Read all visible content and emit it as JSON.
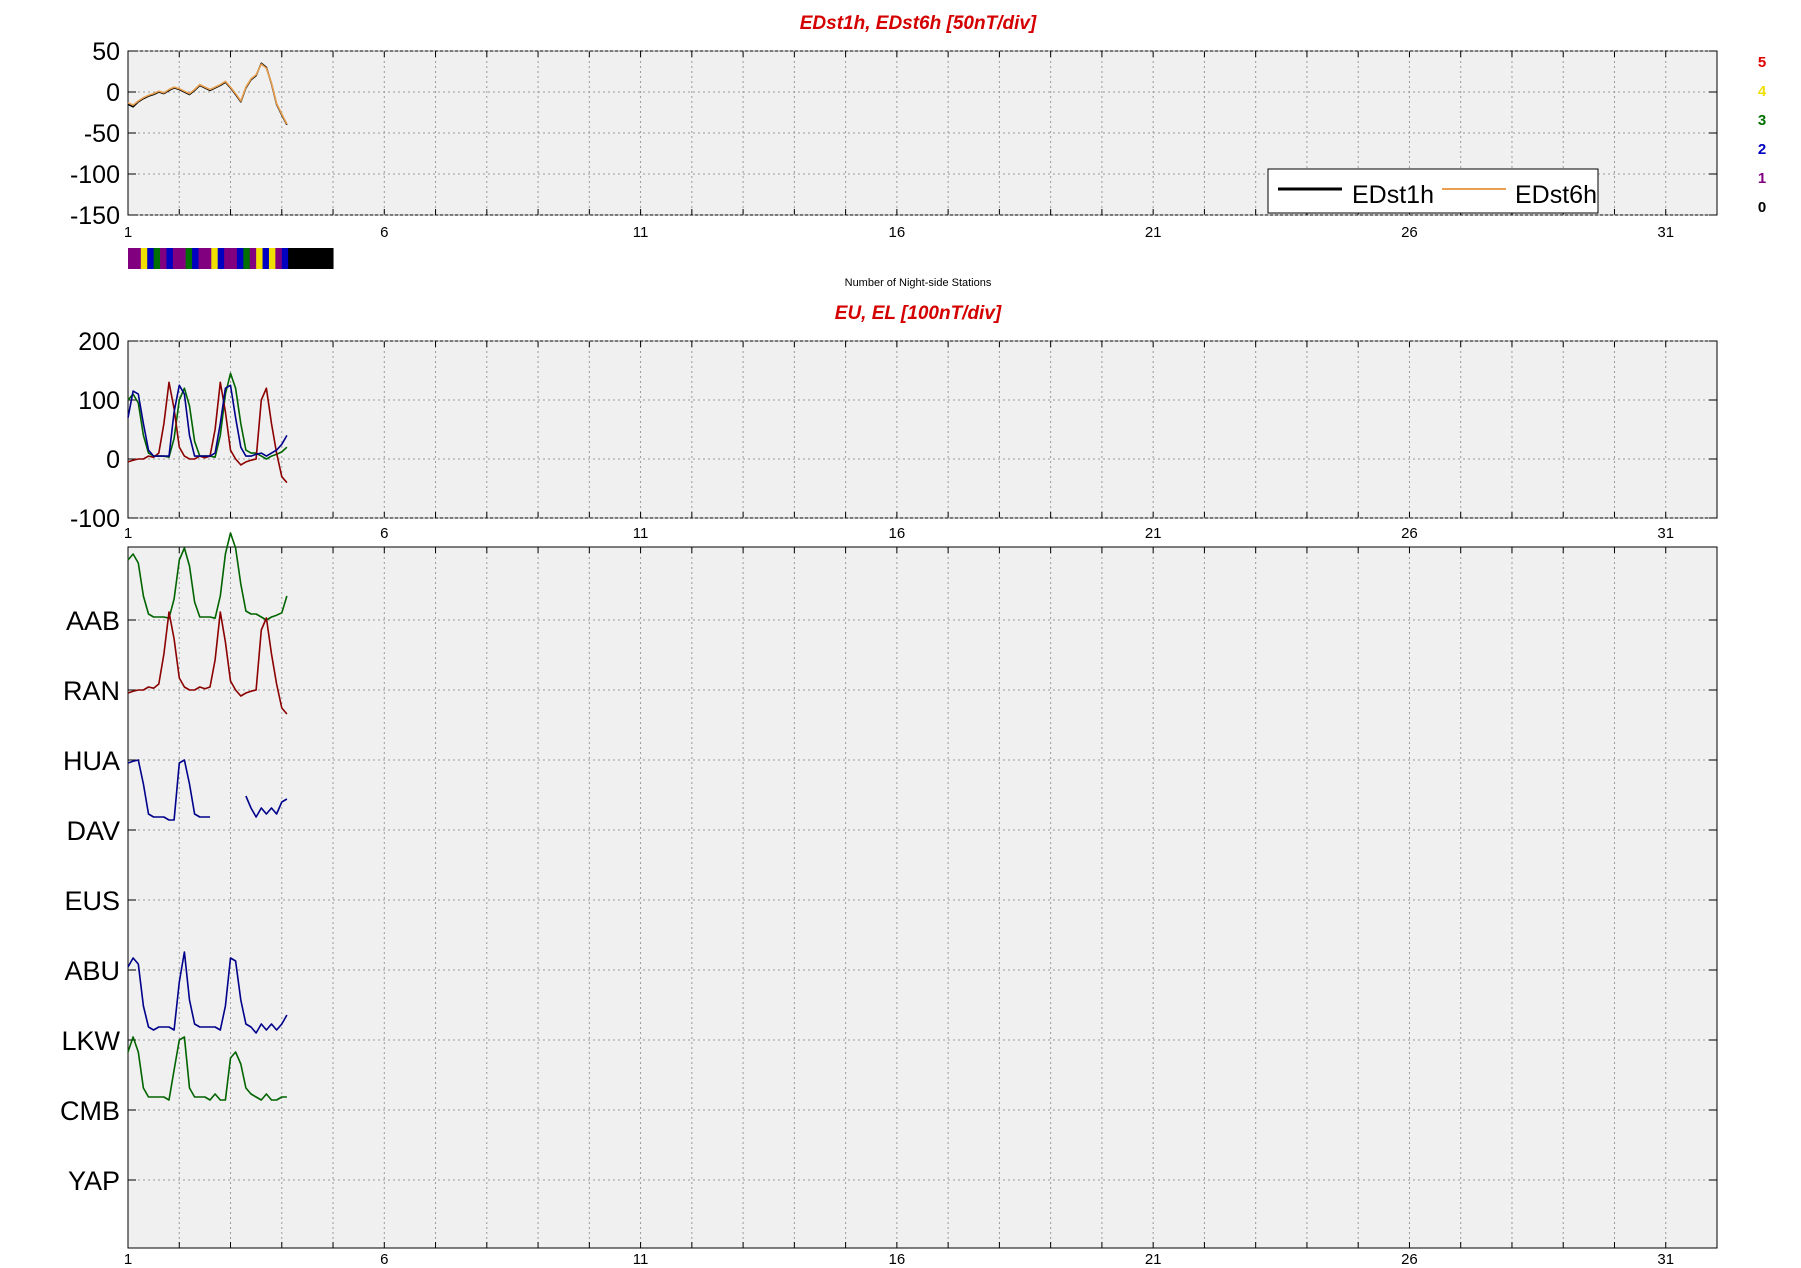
{
  "panels": {
    "dst": {
      "title": "EDst1h, EDst6h [50nT/div]"
    },
    "eu": {
      "title": "EU, EL   [100nT/div]"
    },
    "stations": {
      "title": ""
    }
  },
  "caption": "Number of Night-side Stations",
  "x_tick_labels": [
    "1",
    "6",
    "11",
    "16",
    "21",
    "26",
    "31"
  ],
  "key": {
    "labels": [
      "5",
      "4",
      "3",
      "2",
      "1",
      "0"
    ],
    "colors": [
      "#e00000",
      "#f0e000",
      "#007000",
      "#0000c0",
      "#800080",
      "#000000"
    ]
  },
  "legend": {
    "items": [
      "EDst1h",
      "EDst6h"
    ],
    "colors": [
      "#000000",
      "#e8a050"
    ]
  },
  "chart_data": [
    {
      "type": "line",
      "title": "EDst1h, EDst6h [50nT/div]",
      "xlabel": "",
      "ylabel": "",
      "xlim": [
        1,
        32
      ],
      "ylim": [
        -150,
        50
      ],
      "yticks": [
        50,
        0,
        -50,
        -100,
        -150
      ],
      "xticks": [
        1,
        6,
        11,
        16,
        21,
        26,
        31
      ],
      "grid": true,
      "legend_position": "bottom-right",
      "series": [
        {
          "name": "EDst1h",
          "color": "#000000",
          "x": [
            1.0,
            1.1,
            1.2,
            1.3,
            1.4,
            1.5,
            1.6,
            1.7,
            1.8,
            1.9,
            2.0,
            2.1,
            2.2,
            2.3,
            2.4,
            2.5,
            2.6,
            2.7,
            2.8,
            2.9,
            3.0,
            3.1,
            3.2,
            3.3,
            3.4,
            3.5,
            3.6,
            3.7,
            3.8,
            3.9,
            4.0,
            4.1
          ],
          "y": [
            -15,
            -18,
            -12,
            -8,
            -5,
            -3,
            0,
            -2,
            2,
            5,
            3,
            0,
            -3,
            2,
            8,
            5,
            2,
            5,
            8,
            12,
            5,
            -3,
            -12,
            5,
            15,
            20,
            35,
            30,
            10,
            -15,
            -28,
            -40
          ]
        },
        {
          "name": "EDst6h",
          "color": "#e8a050",
          "x": [
            1.0,
            1.1,
            1.2,
            1.3,
            1.4,
            1.5,
            1.6,
            1.7,
            1.8,
            1.9,
            2.0,
            2.1,
            2.2,
            2.3,
            2.4,
            2.5,
            2.6,
            2.7,
            2.8,
            2.9,
            3.0,
            3.1,
            3.2,
            3.3,
            3.4,
            3.5,
            3.6,
            3.7,
            3.8,
            3.9,
            4.0,
            4.1
          ],
          "y": [
            -13,
            -16,
            -11,
            -7,
            -4,
            -2,
            1,
            -1,
            3,
            6,
            4,
            1,
            -2,
            3,
            9,
            6,
            3,
            6,
            9,
            13,
            6,
            -2,
            -11,
            6,
            16,
            21,
            34,
            29,
            11,
            -14,
            -27,
            -39
          ]
        }
      ]
    },
    {
      "type": "bar",
      "title": "Number of Night-side Stations",
      "xlim": [
        1,
        32
      ],
      "categories": [
        "0",
        "1",
        "2",
        "3",
        "4",
        "5"
      ],
      "segment_start_day": 1,
      "segment_width_days": 0.125,
      "values": [
        1,
        1,
        4,
        2,
        3,
        1,
        2,
        1,
        1,
        3,
        2,
        1,
        1,
        4,
        2,
        1,
        1,
        2,
        3,
        1,
        4,
        2,
        4,
        1,
        2,
        0,
        0,
        0,
        0,
        0,
        0,
        0
      ]
    },
    {
      "type": "line",
      "title": "EU, EL   [100nT/div]",
      "xlim": [
        1,
        32
      ],
      "ylim": [
        -100,
        200
      ],
      "yticks": [
        200,
        100,
        0,
        -100
      ],
      "xticks": [
        1,
        6,
        11,
        16,
        21,
        26,
        31
      ],
      "grid": true,
      "series": [
        {
          "color": "#006400",
          "x": [
            1.0,
            1.1,
            1.2,
            1.3,
            1.4,
            1.5,
            1.6,
            1.7,
            1.8,
            1.9,
            2.0,
            2.1,
            2.2,
            2.3,
            2.4,
            2.5,
            2.6,
            2.7,
            2.8,
            2.9,
            3.0,
            3.1,
            3.2,
            3.3,
            3.4,
            3.5,
            3.6,
            3.7,
            3.8,
            3.9,
            4.0,
            4.1
          ],
          "y": [
            100,
            110,
            95,
            40,
            10,
            5,
            5,
            5,
            3,
            35,
            100,
            120,
            90,
            30,
            5,
            5,
            5,
            3,
            40,
            110,
            145,
            120,
            60,
            15,
            10,
            10,
            5,
            0,
            5,
            8,
            12,
            20
          ]
        },
        {
          "color": "#8b0000",
          "x": [
            1.0,
            1.1,
            1.2,
            1.3,
            1.4,
            1.5,
            1.6,
            1.7,
            1.8,
            1.9,
            2.0,
            2.1,
            2.2,
            2.3,
            2.4,
            2.5,
            2.6,
            2.7,
            2.8,
            2.9,
            3.0,
            3.1,
            3.2,
            3.3,
            3.4,
            3.5,
            3.6,
            3.7,
            3.8,
            3.9,
            4.0,
            4.1
          ],
          "y": [
            -5,
            -2,
            0,
            0,
            5,
            3,
            10,
            60,
            130,
            85,
            20,
            5,
            0,
            0,
            5,
            2,
            5,
            50,
            130,
            80,
            15,
            0,
            -10,
            -5,
            -2,
            0,
            100,
            120,
            60,
            10,
            -30,
            -40
          ]
        },
        {
          "color": "#00008b",
          "x": [
            1.0,
            1.1,
            1.2,
            1.3,
            1.4,
            1.5,
            1.6,
            1.7,
            1.8,
            1.9,
            2.0,
            2.1,
            2.2,
            2.3,
            2.4,
            2.5,
            2.6,
            2.7,
            2.8,
            2.9,
            3.0,
            3.1,
            3.2,
            3.3,
            3.4,
            3.5,
            3.6,
            3.7,
            3.8,
            3.9,
            4.0,
            4.1
          ],
          "y": [
            70,
            115,
            110,
            60,
            15,
            5,
            5,
            5,
            5,
            80,
            125,
            110,
            40,
            5,
            5,
            5,
            5,
            10,
            60,
            120,
            125,
            70,
            20,
            5,
            5,
            8,
            10,
            5,
            10,
            15,
            25,
            40
          ]
        }
      ]
    },
    {
      "type": "line",
      "title": "",
      "xlim": [
        1,
        32
      ],
      "xticks": [
        1,
        6,
        11,
        16,
        21,
        26,
        31
      ],
      "grid": true,
      "stations": [
        "AAB",
        "RAN",
        "HUA",
        "DAV",
        "EUS",
        "ABU",
        "LKW",
        "CMB",
        "YAP"
      ],
      "series": [
        {
          "name": "AAB",
          "color": "#006400",
          "x": [
            1.0,
            1.1,
            1.2,
            1.3,
            1.4,
            1.5,
            1.6,
            1.7,
            1.8,
            1.9,
            2.0,
            2.1,
            2.2,
            2.3,
            2.4,
            2.5,
            2.6,
            2.7,
            2.8,
            2.9,
            3.0,
            3.1,
            3.2,
            3.3,
            3.4,
            3.5,
            3.6,
            3.7,
            3.8,
            3.9,
            4.0,
            4.1
          ],
          "y": [
            100,
            110,
            95,
            40,
            10,
            5,
            5,
            5,
            3,
            35,
            100,
            120,
            90,
            30,
            5,
            5,
            5,
            3,
            40,
            110,
            145,
            120,
            60,
            15,
            10,
            10,
            5,
            0,
            5,
            8,
            12,
            40
          ]
        },
        {
          "name": "RAN",
          "color": "#8b0000",
          "x": [
            1.0,
            1.1,
            1.2,
            1.3,
            1.4,
            1.5,
            1.6,
            1.7,
            1.8,
            1.9,
            2.0,
            2.1,
            2.2,
            2.3,
            2.4,
            2.5,
            2.6,
            2.7,
            2.8,
            2.9,
            3.0,
            3.1,
            3.2,
            3.3,
            3.4,
            3.5,
            3.6,
            3.7,
            3.8,
            3.9,
            4.0,
            4.1
          ],
          "y": [
            -5,
            -2,
            0,
            0,
            5,
            3,
            10,
            60,
            130,
            85,
            20,
            5,
            0,
            0,
            5,
            2,
            5,
            50,
            130,
            80,
            15,
            0,
            -10,
            -5,
            -2,
            0,
            100,
            120,
            60,
            10,
            -30,
            -40
          ]
        },
        {
          "name": "HUA",
          "color": "#00008b",
          "x": [
            1.0,
            1.1,
            1.2,
            1.3,
            1.4,
            1.5,
            1.6,
            1.7,
            1.8,
            1.9,
            2.0,
            2.1,
            2.2,
            2.3,
            2.4,
            2.5,
            2.6,
            2.7,
            2.8,
            2.9,
            3.0,
            3.1,
            3.2,
            3.3,
            3.4,
            3.5,
            3.6,
            3.7,
            3.8,
            3.9,
            4.0,
            4.1
          ],
          "y": [
            -5,
            -2,
            0,
            -40,
            -90,
            -95,
            -95,
            -95,
            -100,
            -100,
            -5,
            0,
            -40,
            -90,
            -95,
            -95,
            -95,
            null,
            null,
            null,
            null,
            null,
            null,
            -60,
            -80,
            -95,
            -80,
            -90,
            -80,
            -90,
            -70,
            -65
          ]
        },
        {
          "name": "DAV",
          "color": "#00008b",
          "x": [],
          "y": []
        },
        {
          "name": "EUS",
          "color": "#00008b",
          "x": [],
          "y": []
        },
        {
          "name": "ABU",
          "color": "#00008b",
          "x": [
            1.0,
            1.1,
            1.2,
            1.3,
            1.4,
            1.5,
            1.6,
            1.7,
            1.8,
            1.9,
            2.0,
            2.1,
            2.2,
            2.3,
            2.4,
            2.5,
            2.6,
            2.7,
            2.8,
            2.9,
            3.0,
            3.1,
            3.2,
            3.3,
            3.4,
            3.5,
            3.6,
            3.7,
            3.8,
            3.9,
            4.0,
            4.1
          ],
          "y": [
            5,
            20,
            10,
            -60,
            -95,
            -100,
            -95,
            -95,
            -95,
            -100,
            -20,
            30,
            -50,
            -90,
            -95,
            -95,
            -95,
            -95,
            -100,
            -60,
            20,
            15,
            -50,
            -90,
            -95,
            -105,
            -90,
            -100,
            -90,
            -100,
            -90,
            -75
          ]
        },
        {
          "name": "LKW",
          "color": "#006400",
          "x": [
            1.0,
            1.1,
            1.2,
            1.3,
            1.4,
            1.5,
            1.6,
            1.7,
            1.8,
            1.9,
            2.0,
            2.1,
            2.2,
            2.3,
            2.4,
            2.5,
            2.6,
            2.7,
            2.8,
            2.9,
            3.0,
            3.1,
            3.2,
            3.3,
            3.4,
            3.5,
            3.6,
            3.7,
            3.8,
            3.9,
            4.0,
            4.1
          ],
          "y": [
            -20,
            5,
            -20,
            -80,
            -95,
            -95,
            -95,
            -95,
            -100,
            -50,
            0,
            5,
            -80,
            -95,
            -95,
            -95,
            -100,
            -90,
            -100,
            -100,
            -30,
            -20,
            -40,
            -80,
            -90,
            -95,
            -100,
            -90,
            -100,
            -100,
            -95,
            -95
          ]
        },
        {
          "name": "CMB",
          "color": "#000000",
          "x": [],
          "y": []
        },
        {
          "name": "YAP",
          "color": "#000000",
          "x": [],
          "y": []
        }
      ]
    }
  ]
}
